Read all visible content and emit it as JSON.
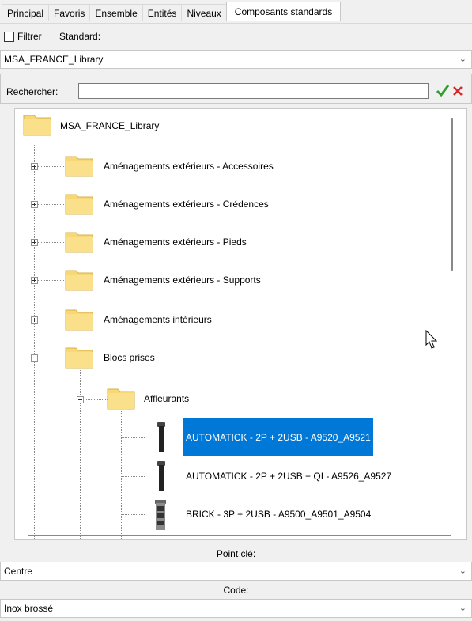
{
  "tabs": [
    {
      "label": "Principal"
    },
    {
      "label": "Favoris"
    },
    {
      "label": "Ensemble"
    },
    {
      "label": "Entités"
    },
    {
      "label": "Niveaux"
    },
    {
      "label": "Composants standards"
    }
  ],
  "filter": {
    "checkbox_label": "Filtrer",
    "standard_label": "Standard:",
    "checked": false
  },
  "library_select": {
    "value": "MSA_FRANCE_Library"
  },
  "search": {
    "label": "Rechercher:",
    "value": ""
  },
  "tree": {
    "root": {
      "label": "MSA_FRANCE_Library"
    },
    "folders": [
      {
        "label": "Aménagements extérieurs - Accessoires",
        "expanded": false
      },
      {
        "label": "Aménagements extérieurs - Crédences",
        "expanded": false
      },
      {
        "label": "Aménagements extérieurs - Pieds",
        "expanded": false
      },
      {
        "label": "Aménagements extérieurs - Supports",
        "expanded": false
      },
      {
        "label": "Aménagements intérieurs",
        "expanded": false
      },
      {
        "label": "Blocs prises",
        "expanded": true
      }
    ],
    "subfolder": {
      "label": "Affleurants",
      "expanded": true
    },
    "items": [
      {
        "label": "AUTOMATICK - 2P + 2USB - A9520_A9521",
        "selected": true
      },
      {
        "label": "AUTOMATICK - 2P + 2USB + QI - A9526_A9527",
        "selected": false
      },
      {
        "label": "BRICK - 3P + 2USB  - A9500_A9501_A9504",
        "selected": false
      }
    ]
  },
  "point_cle": {
    "label": "Point clé:",
    "value": "Centre"
  },
  "code": {
    "label": "Code:",
    "value": "Inox brossé"
  },
  "colors": {
    "selection": "#0078d7",
    "folder": "#f8d775",
    "ok": "#2e9e2e",
    "cancel": "#d42a2a"
  }
}
